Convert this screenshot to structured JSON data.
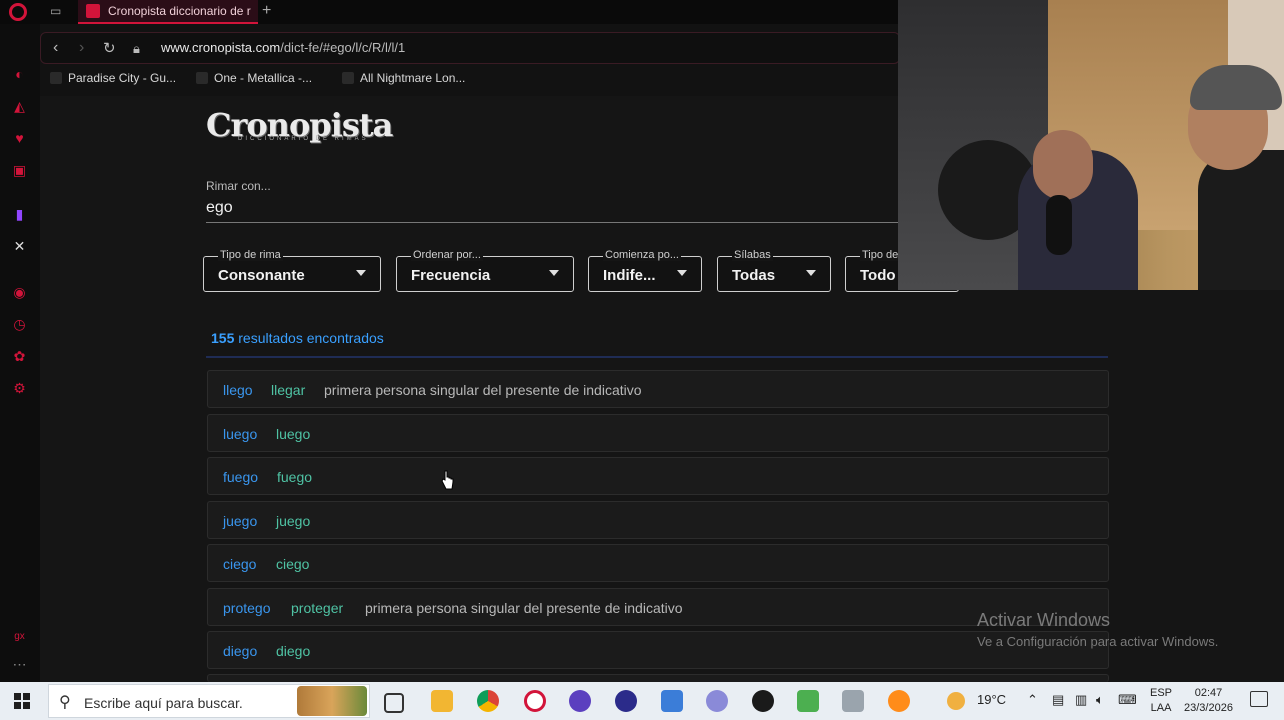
{
  "browser": {
    "tab_title": "Cronopista diccionario de r",
    "url_domain": "www.cronopista.com",
    "url_path": "/dict-fe/#ego/l/c/R/l/l/1",
    "bookmarks": [
      "Paradise City - Gu...",
      "One - Metallica -...",
      "All Nightmare Lon..."
    ]
  },
  "page": {
    "logo": "Cronopista",
    "logo_sub": "DICCIONARIO DE RIMAS",
    "search_label": "Rimar con...",
    "search_value": "ego",
    "filters": [
      {
        "label": "Tipo de rima",
        "value": "Consonante"
      },
      {
        "label": "Ordenar por...",
        "value": "Frecuencia"
      },
      {
        "label": "Comienza po...",
        "value": "Indife..."
      },
      {
        "label": "Sílabas",
        "value": "Todas"
      },
      {
        "label": "Tipo de",
        "value": "Todo"
      }
    ],
    "results_count": "155",
    "results_text": " resultados encontrados",
    "results": [
      {
        "word": "llego",
        "root": "llegar",
        "desc": "primera persona singular del presente de indicativo"
      },
      {
        "word": "luego",
        "root": "luego",
        "desc": ""
      },
      {
        "word": "fuego",
        "root": "fuego",
        "desc": ""
      },
      {
        "word": "juego",
        "root": "juego",
        "desc": ""
      },
      {
        "word": "ciego",
        "root": "ciego",
        "desc": ""
      },
      {
        "word": "protego",
        "root": "proteger",
        "desc": "primera persona singular del presente de indicativo"
      },
      {
        "word": "diego",
        "root": "diego",
        "desc": ""
      }
    ]
  },
  "watermark": {
    "title": "Activar Windows",
    "subtitle": "Ve a Configuración para activar Windows."
  },
  "taskbar": {
    "search_placeholder": "Escribe aquí para buscar.",
    "weather": "19°C",
    "lang1": "ESP",
    "lang2": "LAA",
    "time": "02:47",
    "date": "23/3/2026"
  }
}
